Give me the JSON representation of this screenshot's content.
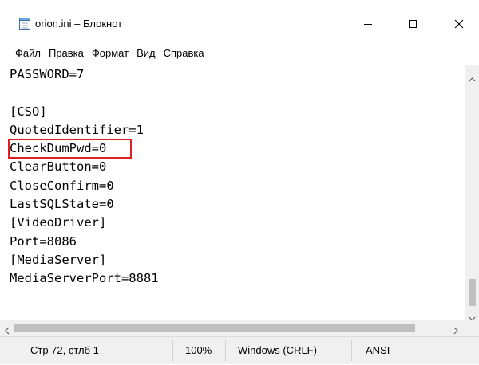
{
  "window": {
    "title": "orion.ini – Блокнот",
    "icon": "notepad-icon",
    "controls": [
      "minimize-icon",
      "maximize-icon",
      "close-icon"
    ]
  },
  "menu": {
    "items": [
      "Файл",
      "Правка",
      "Формат",
      "Вид",
      "Справка"
    ]
  },
  "editor": {
    "lines": [
      "PASSWORD=7",
      "",
      "[CSO]",
      "QuotedIdentifier=1",
      "CheckDumPwd=0",
      "ClearButton=0",
      "CloseConfirm=0",
      "LastSQLState=0",
      "[VideoDriver]",
      "Port=8086",
      "[MediaServer]",
      "MediaServerPort=8881",
      "",
      ""
    ],
    "highlighted_line": "CheckDumPwd=0",
    "highlight_color": "#e02020"
  },
  "status": {
    "position": "Стр 72, стлб 1",
    "zoom": "100%",
    "line_ending": "Windows (CRLF)",
    "encoding": "ANSI"
  }
}
